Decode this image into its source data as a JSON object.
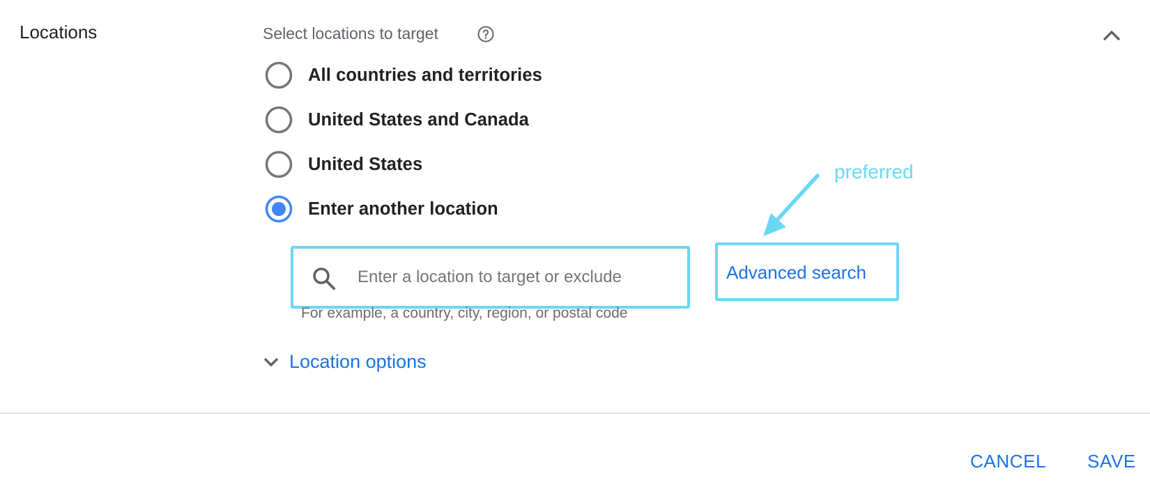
{
  "section": {
    "title": "Locations",
    "subtitle": "Select locations to target",
    "help_icon": "help-circle-icon",
    "collapse_icon": "chevron-up-icon"
  },
  "location_options": [
    {
      "label": "All countries and territories",
      "selected": false
    },
    {
      "label": "United States and Canada",
      "selected": false
    },
    {
      "label": "United States",
      "selected": false
    },
    {
      "label": "Enter another location",
      "selected": true
    }
  ],
  "search": {
    "placeholder": "Enter a location to target or exclude",
    "value": "",
    "helper_text": "For example, a country, city, region, or postal code",
    "icon": "search-icon"
  },
  "advanced_search": {
    "label": "Advanced search"
  },
  "annotation": {
    "text": "preferred",
    "color": "#6ad8f4"
  },
  "more_options": {
    "label": "Location options",
    "icon": "chevron-down-icon"
  },
  "footer": {
    "cancel_label": "CANCEL",
    "save_label": "SAVE"
  },
  "colors": {
    "accent": "#1a73e8",
    "radio_selected": "#4285f4",
    "radio_unselected": "#757575",
    "highlight": "#6ad8f4"
  }
}
